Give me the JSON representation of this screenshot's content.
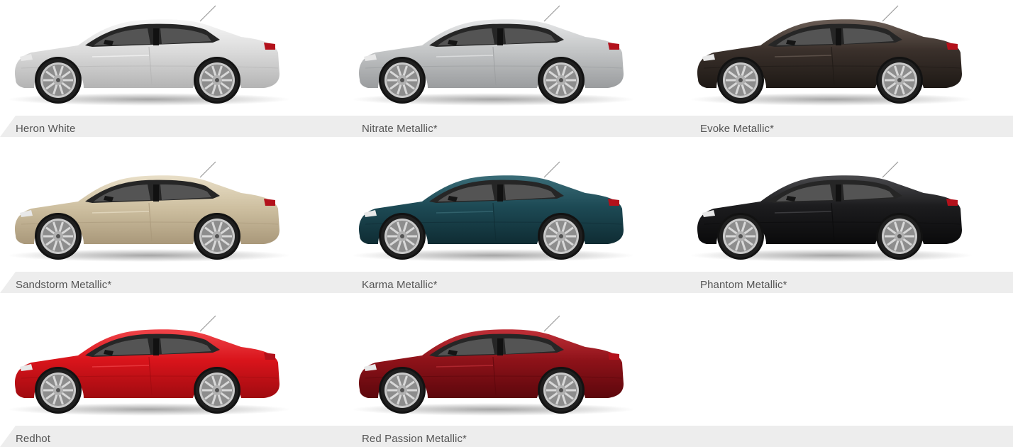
{
  "swatches": [
    {
      "name": "Heron White",
      "body": "#dcdcdc",
      "highlight": "#f7f7f7",
      "shadow": "#b4b4b4"
    },
    {
      "name": "Nitrate Metallic*",
      "body": "#c4c6c7",
      "highlight": "#e6e7e8",
      "shadow": "#9a9c9e"
    },
    {
      "name": "Evoke Metallic*",
      "body": "#3a302b",
      "highlight": "#6b5e56",
      "shadow": "#1e1915"
    },
    {
      "name": "Sandstorm Metallic*",
      "body": "#cfc1a2",
      "highlight": "#e9dfc8",
      "shadow": "#a9987a"
    },
    {
      "name": "Karma Metallic*",
      "body": "#1d4a55",
      "highlight": "#3b6d78",
      "shadow": "#0f2c33"
    },
    {
      "name": "Phantom Metallic*",
      "body": "#1c1c1e",
      "highlight": "#4a4a4d",
      "shadow": "#0a0a0b"
    },
    {
      "name": "Redhot",
      "body": "#d9141b",
      "highlight": "#f0454a",
      "shadow": "#a00b10"
    },
    {
      "name": "Red Passion Metallic*",
      "body": "#8e1219",
      "highlight": "#c03038",
      "shadow": "#5c070c"
    }
  ]
}
